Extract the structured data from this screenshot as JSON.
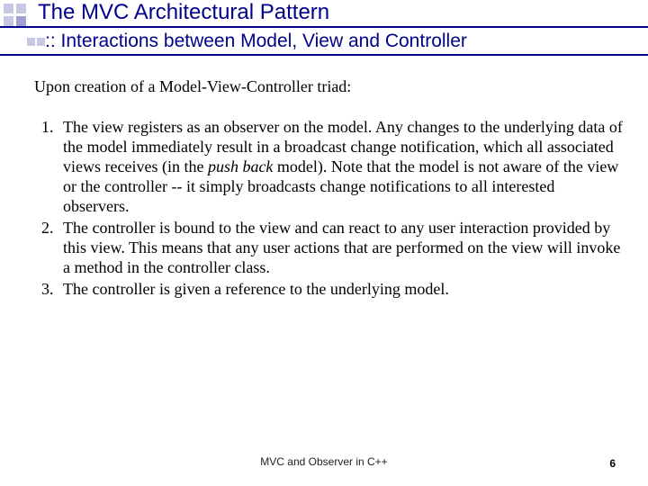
{
  "header": {
    "main_title": "The MVC Architectural Pattern",
    "sub_title": ":: Interactions between Model, View and Controller"
  },
  "body": {
    "intro": "Upon creation of a Model-View-Controller triad:",
    "items": [
      {
        "pre": "The view registers as an observer on the model. Any changes to the underlying data of the model immediately result in a broadcast change notification, which all associated views receives (in the ",
        "em": "push back",
        "post": " model). Note that the model is not aware of the view or the controller -- it simply broadcasts change notifications to all interested observers."
      },
      {
        "pre": "The controller is bound to the view and can react to any user interaction provided by this view. This means that any user actions that are performed on the view will invoke a method in the controller class.",
        "em": "",
        "post": ""
      },
      {
        "pre": "The controller is given a reference to the underlying model.",
        "em": "",
        "post": ""
      }
    ]
  },
  "footer": {
    "center": "MVC and Observer in C++",
    "page": "6"
  }
}
